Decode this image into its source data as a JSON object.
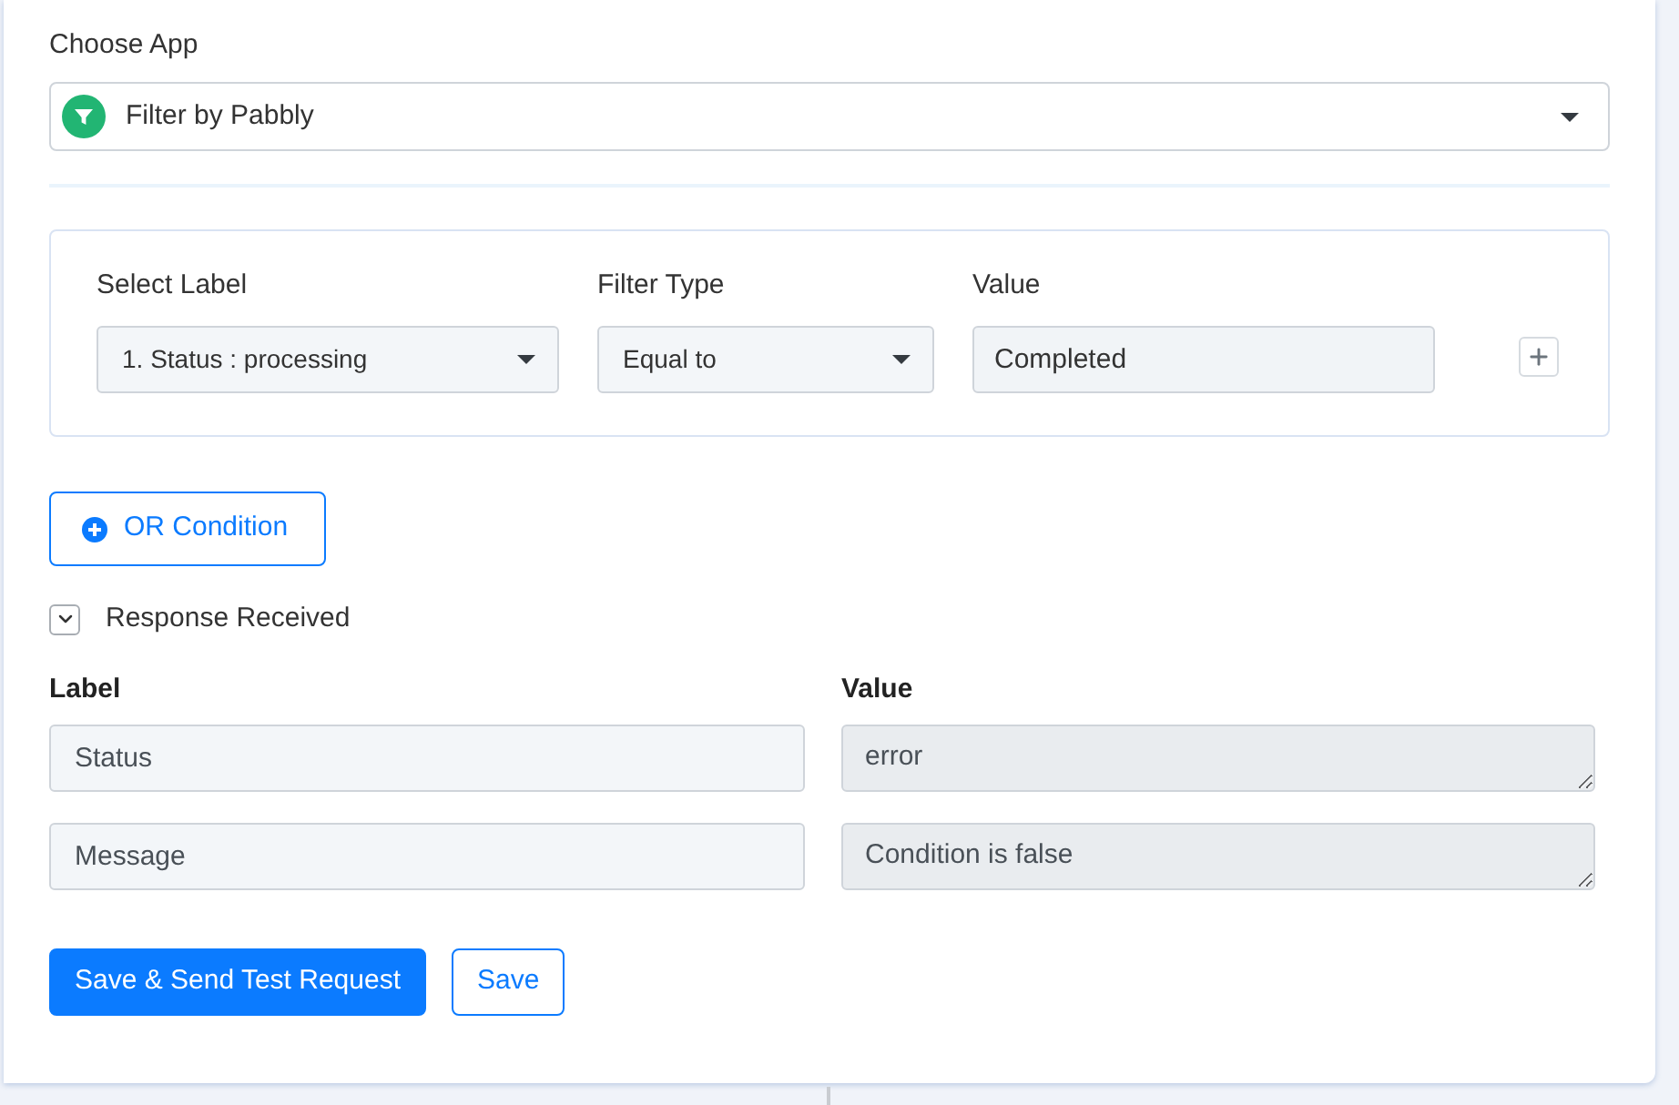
{
  "choose_app": {
    "label": "Choose App",
    "value": "Filter by Pabbly"
  },
  "filter": {
    "fields": [
      {
        "label": "Select Label",
        "kind": "select",
        "value": "1. Status : processing"
      },
      {
        "label": "Filter Type",
        "kind": "select",
        "value": "Equal to"
      },
      {
        "label": "Value",
        "kind": "input",
        "value": "Completed"
      }
    ]
  },
  "or_condition": {
    "label": "OR Condition"
  },
  "response": {
    "title": "Response Received",
    "expanded": true,
    "label_heading": "Label",
    "value_heading": "Value",
    "rows": [
      {
        "label": "Status",
        "value": "error"
      },
      {
        "label": "Message",
        "value": "Condition is false"
      }
    ]
  },
  "buttons": [
    {
      "label": "Save & Send Test Request",
      "kind": "primary"
    },
    {
      "label": "Save",
      "kind": "outline"
    }
  ]
}
